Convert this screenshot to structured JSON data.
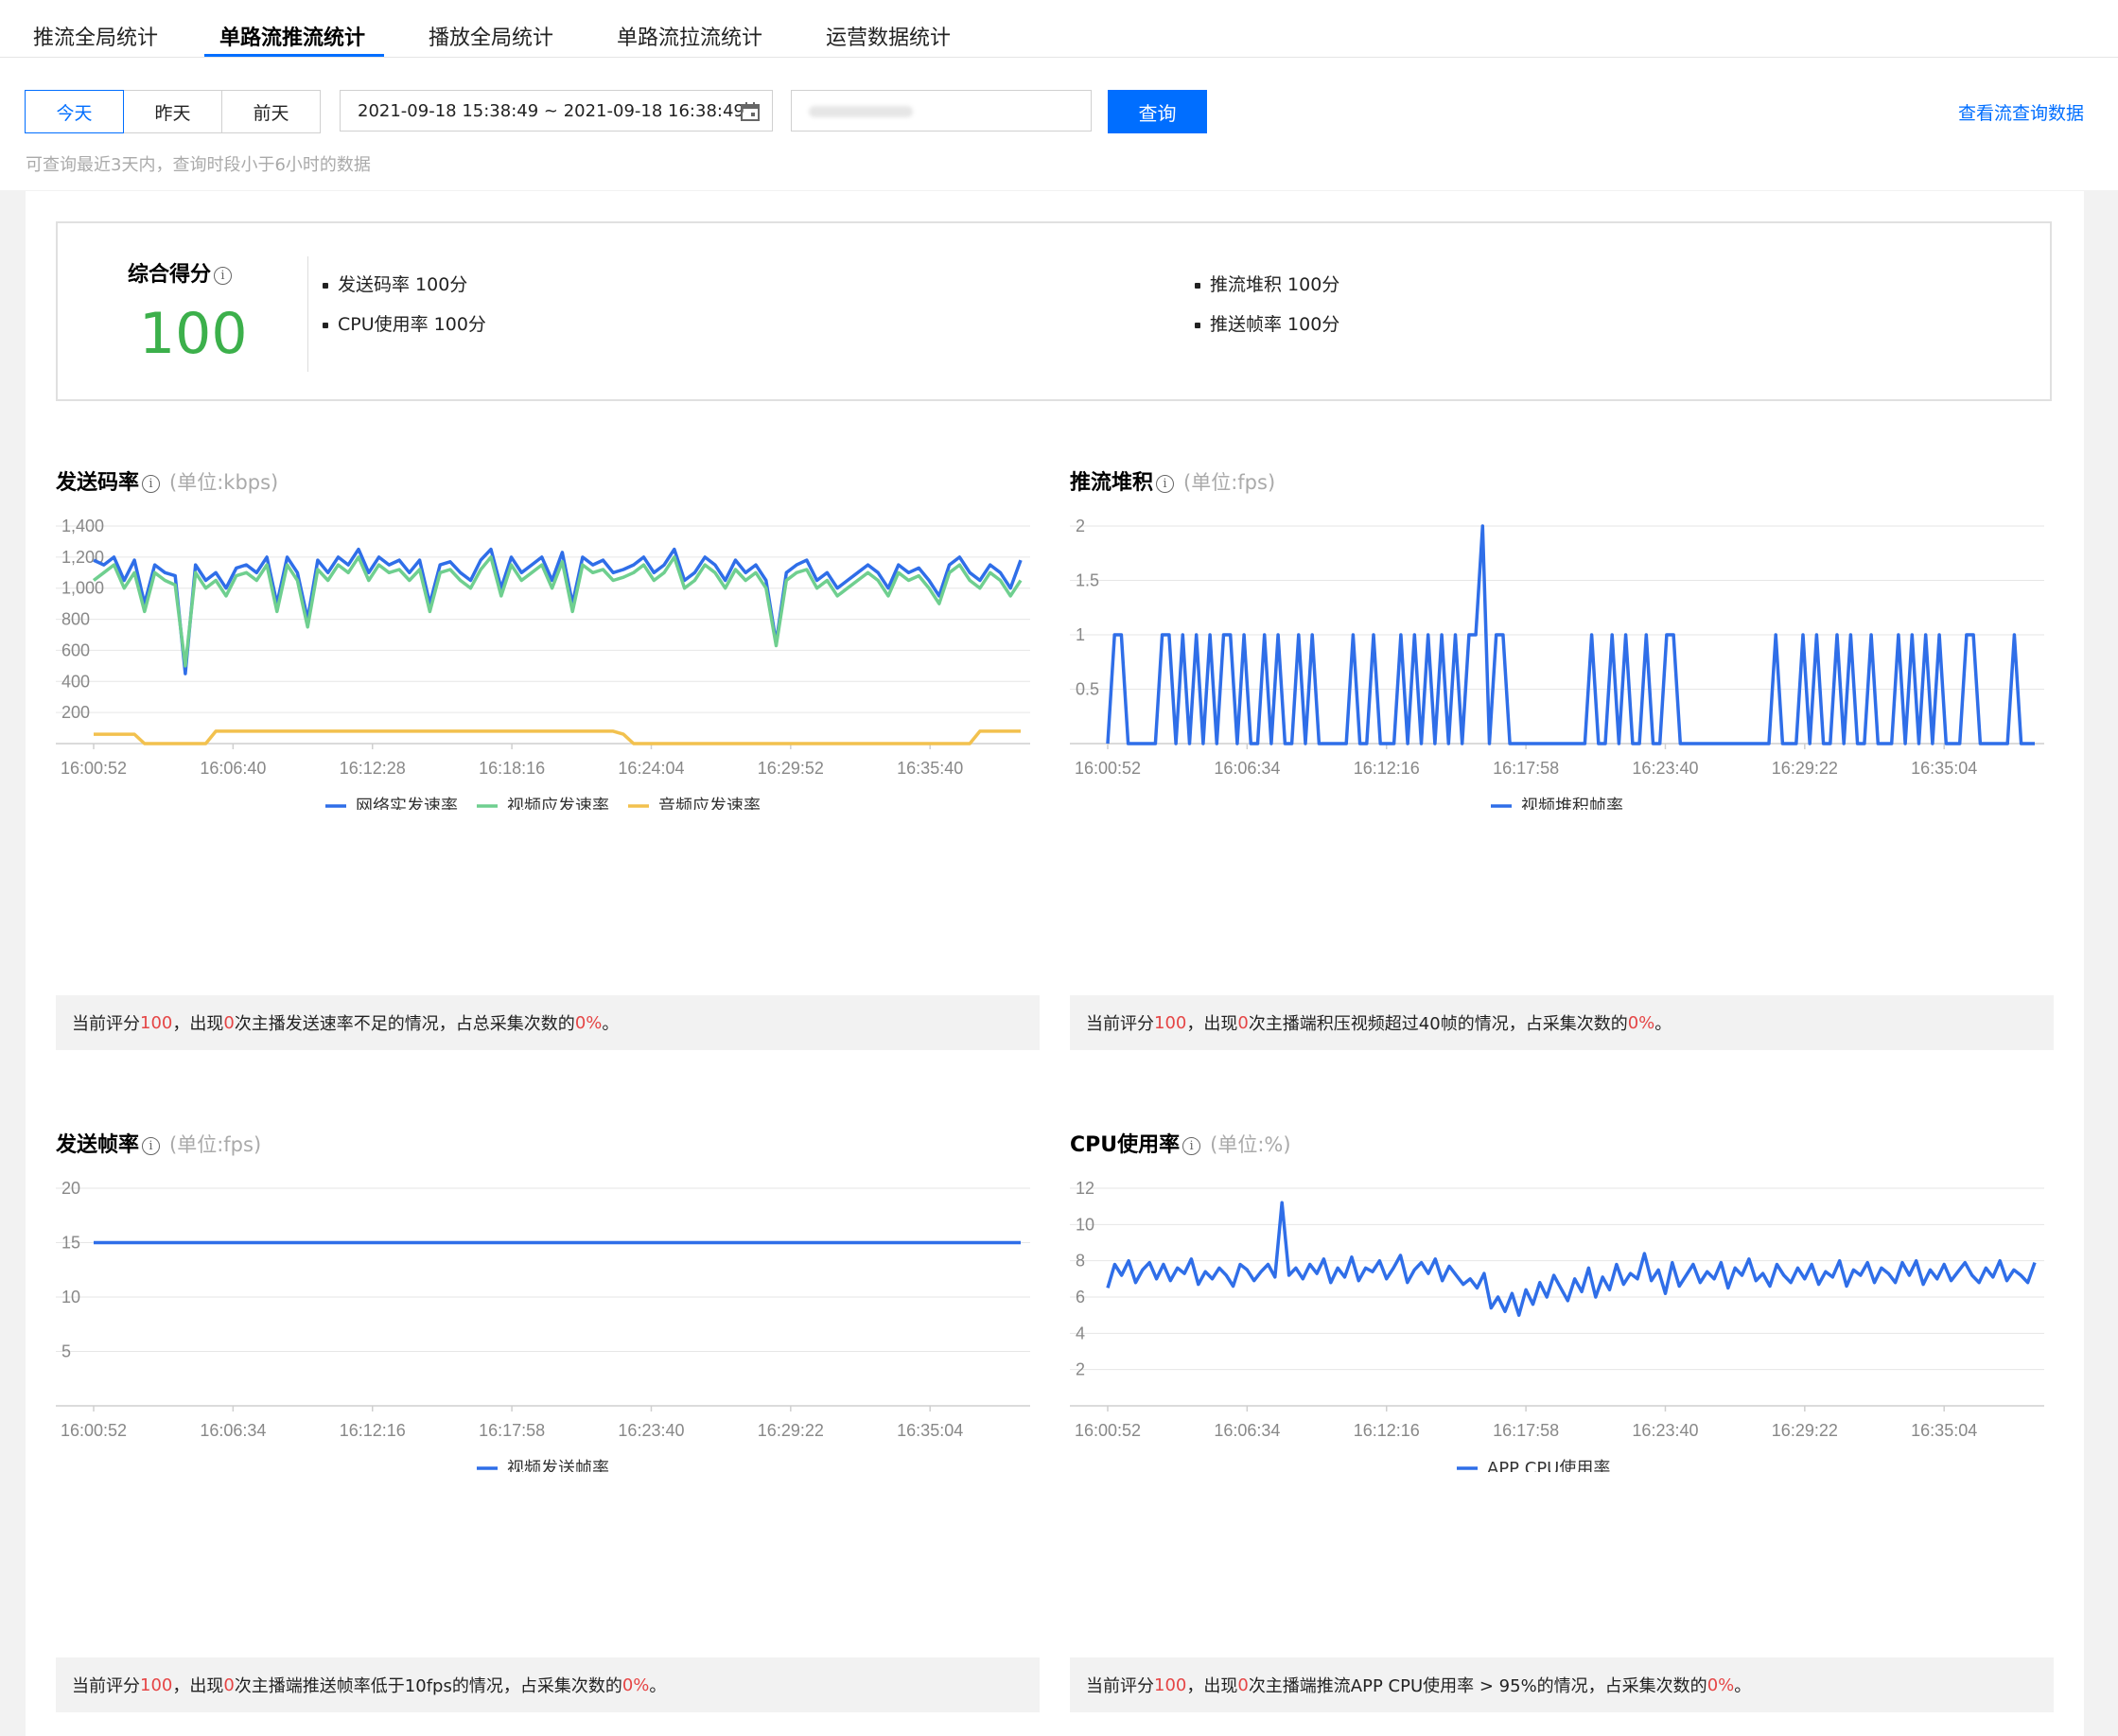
{
  "tabs": [
    "推流全局统计",
    "单路流推流统计",
    "播放全局统计",
    "单路流拉流统计",
    "运营数据统计"
  ],
  "toolbar": {
    "day_buttons": [
      "今天",
      "昨天",
      "前天"
    ],
    "date_range": "2021-09-18 15:38:49 ~ 2021-09-18 16:38:49",
    "query_label": "查询",
    "view_link": "查看流查询数据",
    "hint": "可查询最近3天内，查询时段小于6小时的数据"
  },
  "score": {
    "title": "综合得分",
    "value": "100",
    "items": [
      "发送码率 100分",
      "CPU使用率 100分",
      "推流堆积 100分",
      "推送帧率 100分"
    ]
  },
  "charts": {
    "bitrate": {
      "title": "发送码率",
      "unit": "(单位:kbps)",
      "summary": {
        "p1": "当前评分 ",
        "score": "100",
        "p2": "，出现 ",
        "count": "0",
        "p3": "次主播发送速率不足的情况，占总采集次数的",
        "pct": "0%",
        "p4": "。"
      }
    },
    "backlog": {
      "title": "推流堆积",
      "unit": "(单位:fps)",
      "summary": {
        "p1": "当前评分 ",
        "score": "100",
        "p2": "，出现 ",
        "count": "0",
        "p3": "次主播端积压视频超过40帧的情况，占采集次数的 ",
        "pct": "0%",
        "p4": "。"
      }
    },
    "fps": {
      "title": "发送帧率",
      "unit": "(单位:fps)",
      "summary": {
        "p1": "当前评分 ",
        "score": "100",
        "p2": "，出现 ",
        "count": "0",
        "p3": "次主播端推送帧率低于10fps的情况，占采集次数的",
        "pct": "0%",
        "p4": "。"
      }
    },
    "cpu": {
      "title": "CPU使用率",
      "unit": "(单位:%)",
      "summary": {
        "p1": "当前评分",
        "score": "100",
        "p2": "，出现",
        "count": "0",
        "p3": "次主播端推流APP CPU使用率 > 95%的情况，占采集次数的",
        "pct": "0%",
        "p4": "。"
      }
    }
  },
  "chart_data": [
    {
      "type": "line",
      "xlabel": "",
      "ylabel": "",
      "x_ticks": [
        "16:00:52",
        "16:06:40",
        "16:12:28",
        "16:18:16",
        "16:24:04",
        "16:29:52",
        "16:35:40"
      ],
      "y_ticks": [
        "200",
        "400",
        "600",
        "800",
        "1,000",
        "1,200",
        "1,400"
      ],
      "ylim": [
        0,
        1400
      ],
      "series": [
        {
          "name": "网络实发速率",
          "color": "#2f6ee8",
          "values": [
            1180,
            1150,
            1200,
            1050,
            1180,
            900,
            1150,
            1100,
            1080,
            450,
            1150,
            1050,
            1100,
            1000,
            1130,
            1150,
            1100,
            1200,
            900,
            1200,
            1100,
            800,
            1180,
            1100,
            1200,
            1150,
            1250,
            1100,
            1200,
            1150,
            1180,
            1100,
            1180,
            900,
            1150,
            1170,
            1100,
            1050,
            1180,
            1250,
            1000,
            1200,
            1100,
            1150,
            1200,
            1050,
            1230,
            900,
            1200,
            1150,
            1180,
            1100,
            1120,
            1150,
            1200,
            1100,
            1150,
            1250,
            1050,
            1100,
            1200,
            1150,
            1050,
            1180,
            1100,
            1150,
            1050,
            650,
            1100,
            1150,
            1180,
            1050,
            1100,
            1000,
            1050,
            1100,
            1150,
            1100,
            1000,
            1150,
            1100,
            1130,
            1050,
            950,
            1150,
            1200,
            1100,
            1050,
            1150,
            1100,
            1000,
            1180
          ]
        },
        {
          "name": "视频应发速率",
          "color": "#6fcf8f",
          "values": [
            1050,
            1100,
            1150,
            1000,
            1100,
            850,
            1100,
            1050,
            1020,
            500,
            1100,
            1000,
            1050,
            950,
            1080,
            1100,
            1050,
            1150,
            850,
            1150,
            1050,
            750,
            1120,
            1050,
            1150,
            1100,
            1200,
            1050,
            1150,
            1100,
            1120,
            1050,
            1120,
            850,
            1100,
            1120,
            1050,
            1000,
            1120,
            1200,
            950,
            1150,
            1050,
            1100,
            1150,
            1000,
            1170,
            850,
            1150,
            1100,
            1120,
            1050,
            1070,
            1100,
            1150,
            1050,
            1100,
            1200,
            1000,
            1050,
            1150,
            1100,
            1000,
            1120,
            1050,
            1100,
            1000,
            630,
            1050,
            1100,
            1120,
            1000,
            1050,
            950,
            1000,
            1050,
            1100,
            1050,
            950,
            1100,
            1050,
            1080,
            1000,
            900,
            1100,
            1150,
            1050,
            1000,
            1100,
            1050,
            950,
            1050
          ]
        },
        {
          "name": "音频应发速率",
          "color": "#f2c14e",
          "values": [
            60,
            60,
            60,
            60,
            60,
            0,
            0,
            0,
            0,
            0,
            0,
            0,
            80,
            80,
            80,
            80,
            80,
            80,
            80,
            80,
            80,
            80,
            80,
            80,
            80,
            80,
            80,
            80,
            80,
            80,
            80,
            80,
            80,
            80,
            80,
            80,
            80,
            80,
            80,
            80,
            80,
            80,
            80,
            80,
            80,
            80,
            80,
            80,
            80,
            80,
            80,
            80,
            60,
            0,
            0,
            0,
            0,
            0,
            0,
            0,
            0,
            0,
            0,
            0,
            0,
            0,
            0,
            0,
            0,
            0,
            0,
            0,
            0,
            0,
            0,
            0,
            0,
            0,
            0,
            0,
            0,
            0,
            0,
            0,
            0,
            0,
            0,
            80,
            80,
            80,
            80,
            80
          ]
        }
      ]
    },
    {
      "type": "line",
      "xlabel": "",
      "ylabel": "",
      "x_ticks": [
        "16:00:52",
        "16:06:34",
        "16:12:16",
        "16:17:58",
        "16:23:40",
        "16:29:22",
        "16:35:04"
      ],
      "y_ticks": [
        "0.5",
        "1",
        "1.5",
        "2"
      ],
      "ylim": [
        0,
        2
      ],
      "series": [
        {
          "name": "视频堆积帧率",
          "color": "#2f6ee8",
          "values": [
            0,
            1,
            1,
            0,
            0,
            0,
            0,
            0,
            1,
            1,
            0,
            1,
            0,
            1,
            0,
            1,
            0,
            1,
            1,
            0,
            1,
            0,
            0,
            1,
            0,
            1,
            0,
            0,
            1,
            0,
            1,
            0,
            0,
            0,
            0,
            0,
            1,
            0,
            0,
            1,
            0,
            0,
            0,
            1,
            0,
            1,
            0,
            1,
            0,
            1,
            0,
            1,
            0,
            1,
            1,
            2,
            0,
            1,
            1,
            0,
            0,
            0,
            0,
            0,
            0,
            0,
            0,
            0,
            0,
            0,
            0,
            1,
            0,
            0,
            1,
            0,
            1,
            0,
            0,
            1,
            0,
            0,
            1,
            1,
            0,
            0,
            0,
            0,
            0,
            0,
            0,
            0,
            0,
            0,
            0,
            0,
            0,
            0,
            1,
            0,
            0,
            0,
            1,
            0,
            1,
            0,
            0,
            1,
            0,
            1,
            0,
            0,
            1,
            0,
            0,
            0,
            1,
            0,
            1,
            0,
            1,
            0,
            1,
            0,
            0,
            0,
            1,
            1,
            0,
            0,
            0,
            0,
            0,
            1,
            0,
            0,
            0
          ]
        }
      ]
    },
    {
      "type": "line",
      "xlabel": "",
      "ylabel": "",
      "x_ticks": [
        "16:00:52",
        "16:06:34",
        "16:12:16",
        "16:17:58",
        "16:23:40",
        "16:29:22",
        "16:35:04"
      ],
      "y_ticks": [
        "5",
        "10",
        "15",
        "20"
      ],
      "ylim": [
        0,
        20
      ],
      "series": [
        {
          "name": "视频发送帧率",
          "color": "#2f6ee8",
          "values": [
            15,
            15,
            15,
            15,
            15,
            15,
            15,
            15,
            15,
            15,
            15,
            15,
            15,
            15
          ]
        }
      ]
    },
    {
      "type": "line",
      "xlabel": "",
      "ylabel": "",
      "x_ticks": [
        "16:00:52",
        "16:06:34",
        "16:12:16",
        "16:17:58",
        "16:23:40",
        "16:29:22",
        "16:35:04"
      ],
      "y_ticks": [
        "2",
        "4",
        "6",
        "8",
        "10",
        "12"
      ],
      "ylim": [
        0,
        12
      ],
      "series": [
        {
          "name": "APP CPU使用率",
          "color": "#2f6ee8",
          "values": [
            6.5,
            7.8,
            7.2,
            8.0,
            6.8,
            7.5,
            7.9,
            7.0,
            7.8,
            6.9,
            7.6,
            7.3,
            8.1,
            6.7,
            7.4,
            7.0,
            7.6,
            7.2,
            6.6,
            7.8,
            7.5,
            6.9,
            7.4,
            7.8,
            7.1,
            11.2,
            7.2,
            7.6,
            7.0,
            7.8,
            7.3,
            8.1,
            6.8,
            7.6,
            7.1,
            8.2,
            6.9,
            7.6,
            7.4,
            8.0,
            7.0,
            7.6,
            8.3,
            6.8,
            7.5,
            7.9,
            7.3,
            8.1,
            6.9,
            7.7,
            7.2,
            6.7,
            7.0,
            6.5,
            7.3,
            5.4,
            6.0,
            5.2,
            6.2,
            5.0,
            6.4,
            5.6,
            6.8,
            6.0,
            7.2,
            6.5,
            5.8,
            7.0,
            6.3,
            7.6,
            6.0,
            7.1,
            6.4,
            7.8,
            6.7,
            7.3,
            7.0,
            8.4,
            6.9,
            7.5,
            6.2,
            7.9,
            6.6,
            7.2,
            7.8,
            6.8,
            7.4,
            7.0,
            7.9,
            6.5,
            7.6,
            7.2,
            8.1,
            6.9,
            7.3,
            6.6,
            7.8,
            7.2,
            6.8,
            7.6,
            7.0,
            7.8,
            6.7,
            7.4,
            7.1,
            8.0,
            6.6,
            7.5,
            7.2,
            7.9,
            6.8,
            7.6,
            7.3,
            6.8,
            7.9,
            7.2,
            8.0,
            6.7,
            7.5,
            7.0,
            7.8,
            6.9,
            7.4,
            7.9,
            7.2,
            6.8,
            7.6,
            7.1,
            8.0,
            6.9,
            7.5,
            7.2,
            6.8,
            7.9
          ]
        }
      ]
    }
  ]
}
